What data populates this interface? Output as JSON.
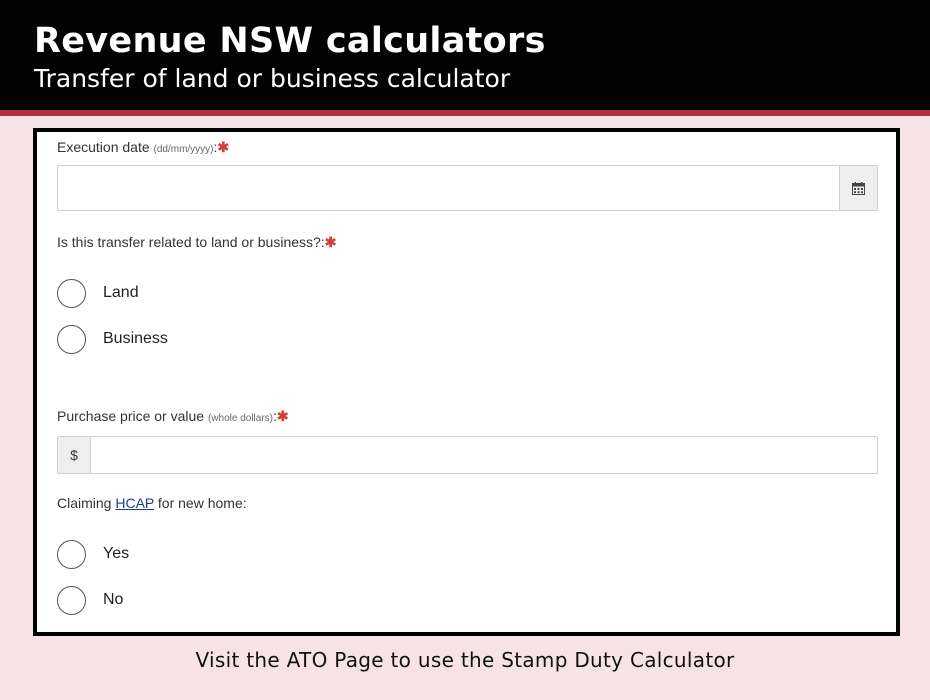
{
  "banner": {
    "title": "Revenue NSW calculators",
    "subtitle": "Transfer of land or business calculator"
  },
  "form": {
    "execution_date": {
      "label": "Execution date",
      "hint": "(dd/mm/yyyy)",
      "suffix": ":",
      "required_mark": "✱",
      "value": "",
      "icon": "calendar-icon"
    },
    "transfer_type": {
      "label": "Is this transfer related to land or business?:",
      "required_mark": "✱",
      "options": [
        "Land",
        "Business"
      ]
    },
    "purchase_price": {
      "label": "Purchase price or value",
      "hint": "(whole dollars)",
      "suffix": ":",
      "required_mark": "✱",
      "prefix": "$",
      "value": ""
    },
    "hcap": {
      "label_before": "Claiming ",
      "link_text": "HCAP",
      "label_after": " for new home:",
      "options": [
        "Yes",
        "No"
      ]
    }
  },
  "footer": {
    "text": "Visit the ATO Page to use the Stamp Duty Calculator"
  },
  "colors": {
    "banner_bg": "#030303",
    "accent": "#b0303c",
    "page_bg": "#f7e3e5",
    "required": "#d0413b",
    "link": "#1b3f8f"
  }
}
